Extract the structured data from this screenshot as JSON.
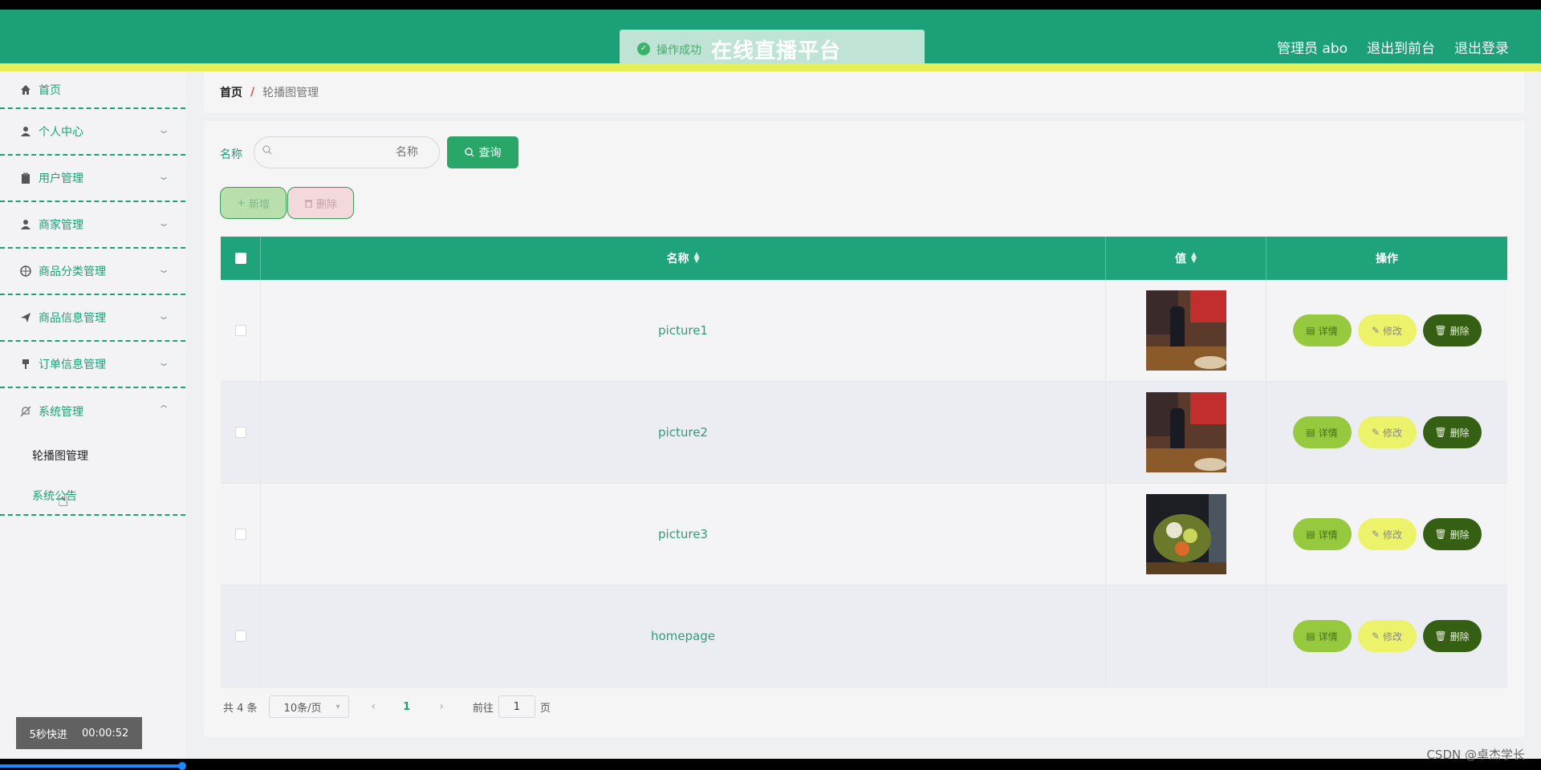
{
  "header": {
    "toast": "操作成功",
    "title": "在线直播平台",
    "links": [
      "管理员 abo",
      "退出到前台",
      "退出登录"
    ]
  },
  "sidebar": {
    "items": [
      {
        "label": "首页",
        "icon": "home-icon"
      },
      {
        "label": "个人中心",
        "icon": "user-icon"
      },
      {
        "label": "用户管理",
        "icon": "clipboard-icon"
      },
      {
        "label": "商家管理",
        "icon": "user-icon"
      },
      {
        "label": "商品分类管理",
        "icon": "globe-icon"
      },
      {
        "label": "商品信息管理",
        "icon": "send-icon"
      },
      {
        "label": "订单信息管理",
        "icon": "brush-icon"
      },
      {
        "label": "系统管理",
        "icon": "bell-off-icon"
      }
    ],
    "submenu": [
      "轮播图管理",
      "系统公告"
    ],
    "fast_forward": {
      "label": "5秒快进",
      "time": "00:00:52"
    }
  },
  "breadcrumb": {
    "home": "首页",
    "sep": "/",
    "current": "轮播图管理"
  },
  "search": {
    "label": "名称",
    "placeholder": "名称",
    "button": "查询"
  },
  "actions": {
    "add": "新增",
    "delete": "删除"
  },
  "table": {
    "headers": [
      "名称",
      "值",
      "操作"
    ],
    "rows": [
      {
        "name": "picture1",
        "image": "food-photo-1"
      },
      {
        "name": "picture2",
        "image": "food-photo-2"
      },
      {
        "name": "picture3",
        "image": "food-photo-3"
      },
      {
        "name": "homepage",
        "image": ""
      }
    ],
    "row_buttons": {
      "detail": "详情",
      "edit": "修改",
      "delete": "删除"
    }
  },
  "pagination": {
    "total": "共 4 条",
    "page_size": "10条/页",
    "current": "1",
    "goto_label": "前往",
    "goto_value": "1",
    "page_suffix": "页"
  },
  "watermark": "CSDN @卓杰学长",
  "colors": {
    "primary": "#1ba078",
    "header_yellow": "#e6ef58",
    "detail": "#96c93d",
    "edit": "#ecf36a",
    "delete": "#355f12"
  }
}
